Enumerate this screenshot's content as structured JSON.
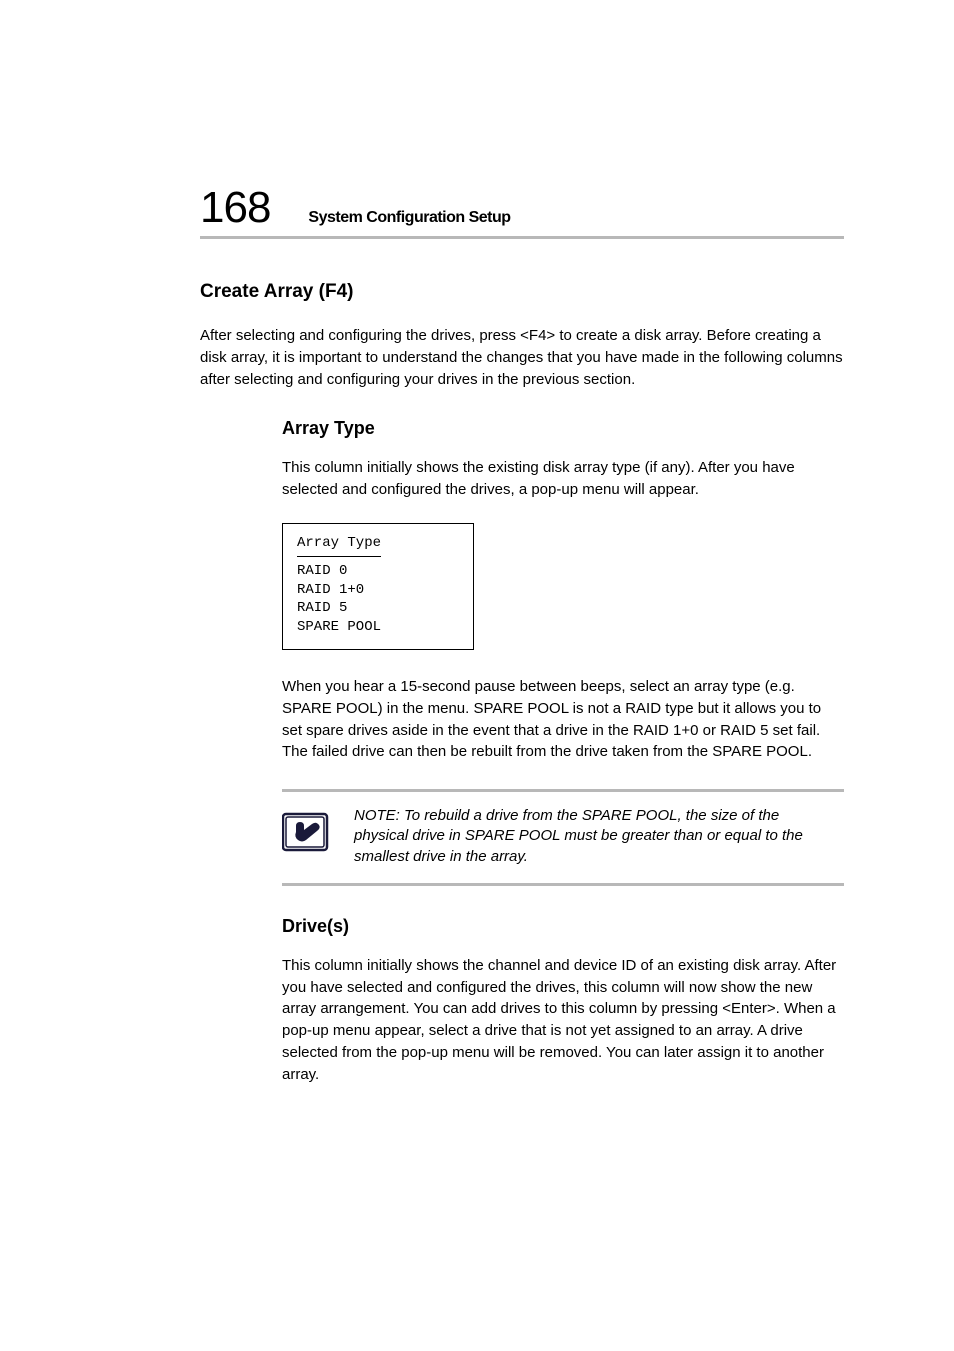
{
  "header": {
    "page_number": "168",
    "title": "System Configuration Setup"
  },
  "section": {
    "title": "Create Array (F4)",
    "para1": "After selecting and configuring the drives, press <F4> to create a disk array. Before creating a disk array, it is important to understand the changes that you have made in the following columns after selecting and configuring your drives in the previous section.",
    "array_type": {
      "title": "Array Type",
      "para": "This column initially shows the existing disk array type (if any). After you have selected and configured the drives, a pop-up menu will appear.",
      "menu": {
        "heading": "Array Type",
        "items": [
          "RAID 0",
          "RAID 1+0",
          "RAID 5",
          "SPARE POOL"
        ]
      },
      "para2": "When you hear a 15-second pause between beeps, select an array type (e.g. SPARE POOL) in the menu. SPARE POOL is not a RAID type but it allows you to set spare drives aside in the event that a drive in the RAID 1+0 or RAID 5 set fail. The failed drive can then be rebuilt from the drive taken from the SPARE POOL."
    },
    "note": "NOTE: To rebuild a drive from the SPARE POOL, the size of the physical drive in SPARE POOL must be greater than or equal to the smallest drive in the array.",
    "drives": {
      "title": "Drive(s)",
      "para": "This column initially shows the channel and device ID of an existing disk array. After you have selected and configured the drives, this column will now show the new array arrangement. You can add drives to this column by pressing <Enter>. When a pop-up menu appear, select a drive that is not yet assigned to an array. A drive selected from the pop-up menu will be removed. You can later assign it to another array."
    }
  }
}
